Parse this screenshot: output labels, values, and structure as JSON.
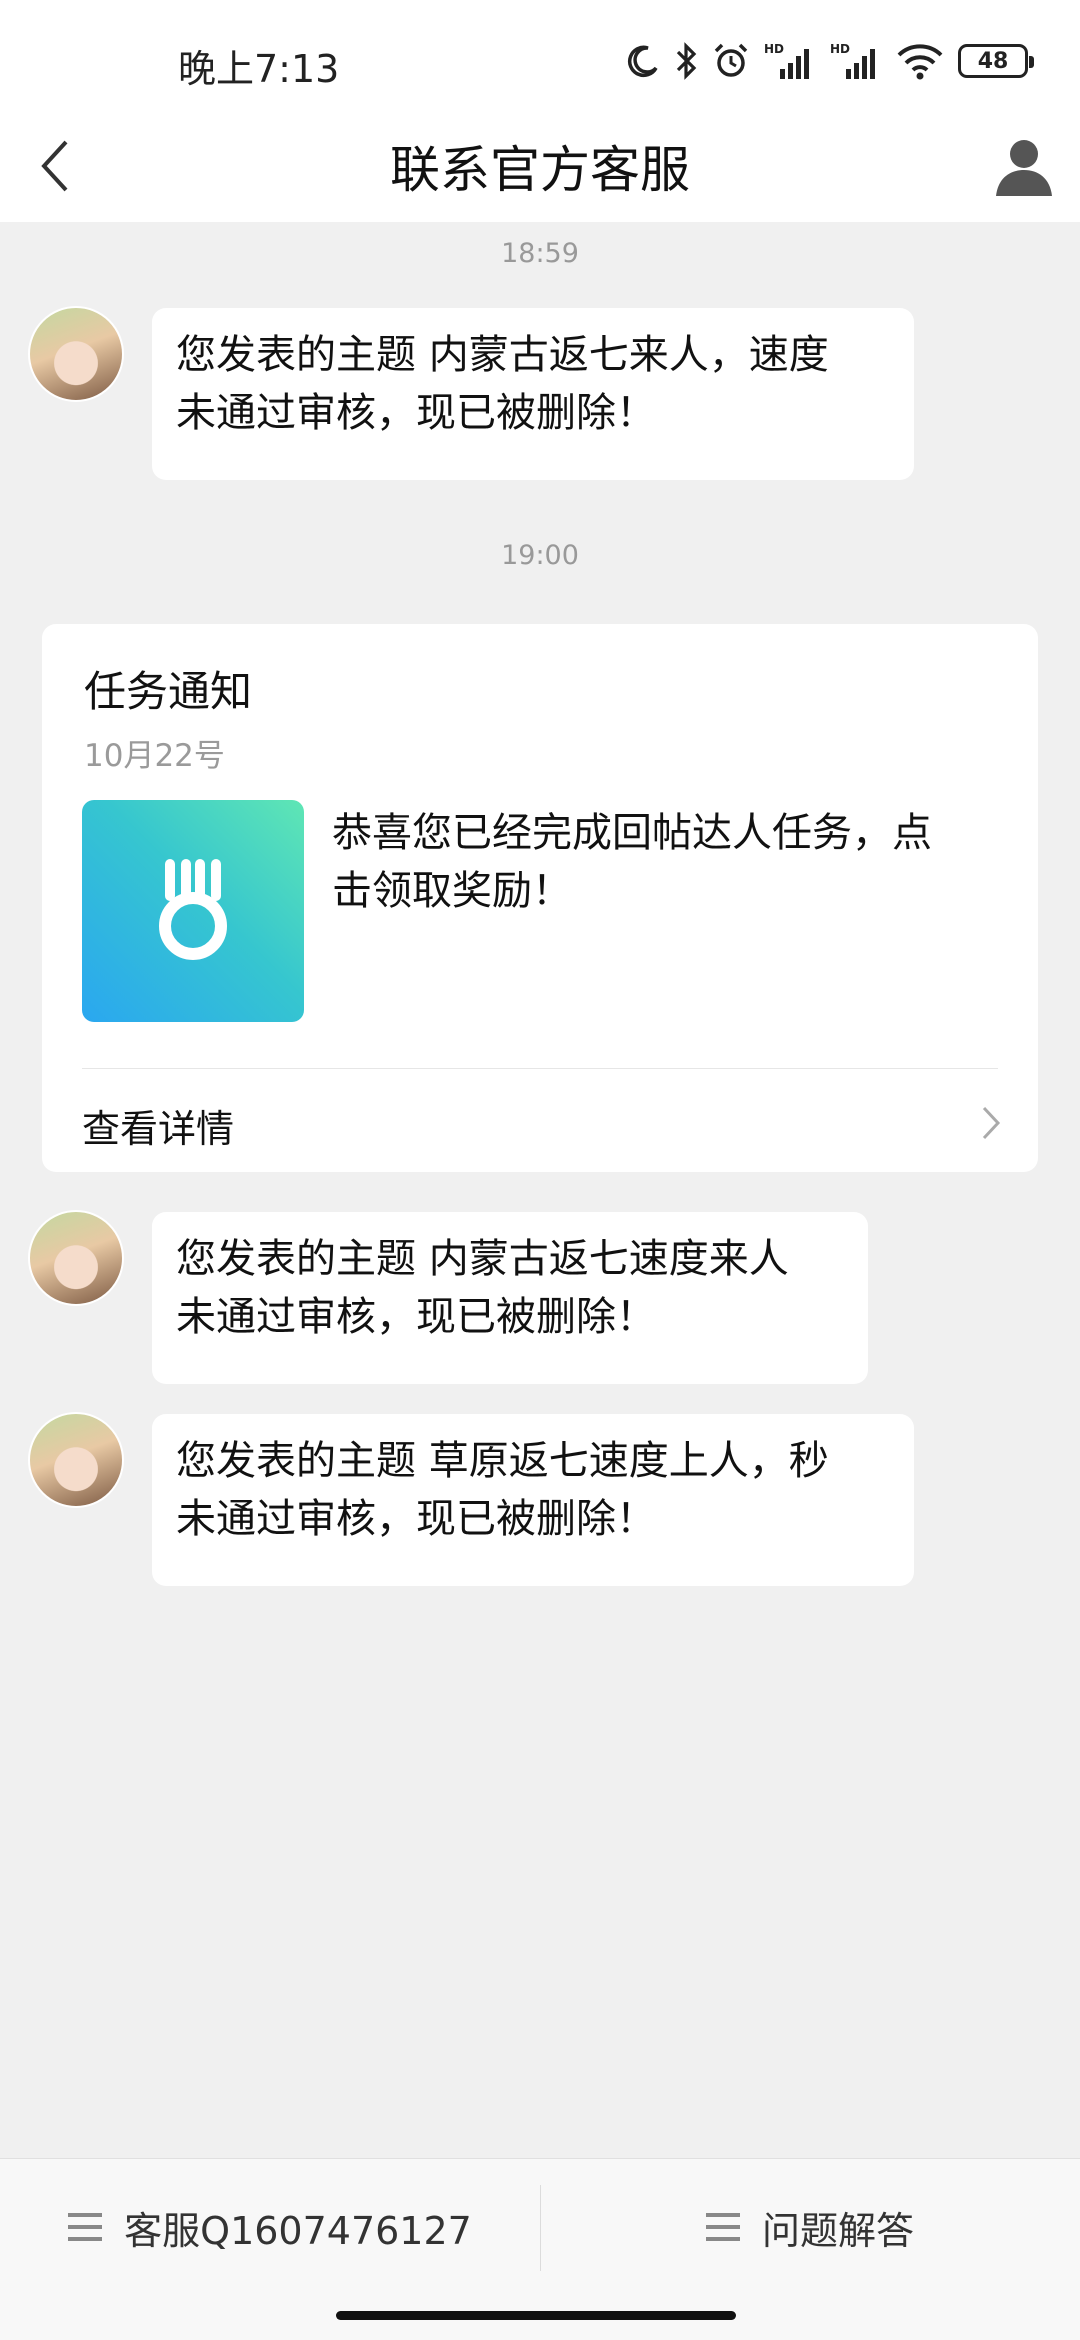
{
  "status_bar": {
    "time": "晚上7:13",
    "battery": "48",
    "icons": [
      "moon-icon",
      "bluetooth-icon",
      "alarm-icon",
      "hd-signal-icon",
      "hd-signal-icon",
      "wifi-icon",
      "battery-icon"
    ]
  },
  "header": {
    "title": "联系官方客服",
    "back_icon": "chevron-left-icon",
    "user_icon": "user-icon"
  },
  "messages": [
    {
      "timestamp": "18:59",
      "type": "text",
      "lines": [
        "您发表的主题 内蒙古返七来人，速度",
        "未通过审核，现已被删除！"
      ]
    },
    {
      "timestamp": "19:00",
      "type": "card",
      "title": "任务通知",
      "date": "10月22号",
      "lines": [
        "恭喜您已经完成回帖达人任务，点",
        "击领取奖励！"
      ],
      "detail_label": "查看详情",
      "thumb_icon": "medal-icon"
    },
    {
      "type": "text",
      "lines": [
        "您发表的主题 内蒙古返七速度来人",
        "未通过审核，现已被删除！"
      ]
    },
    {
      "type": "text",
      "lines": [
        "您发表的主题 草原返七速度上人，秒",
        "未通过审核，现已被删除！"
      ]
    }
  ],
  "bottom_bar": {
    "items": [
      {
        "label": "客服Q1607476127",
        "icon": "menu-icon"
      },
      {
        "label": "问题解答",
        "icon": "menu-icon"
      }
    ]
  },
  "colors": {
    "background": "#f0f0f0",
    "bubble": "#ffffff",
    "timestamp": "#999999",
    "thumb_gradient_start": "#5fe6b4",
    "thumb_gradient_end": "#2aa7f0"
  }
}
